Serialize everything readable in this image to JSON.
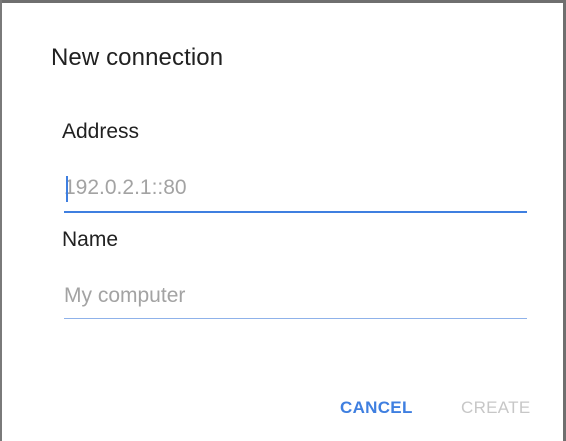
{
  "dialog": {
    "title": "New connection",
    "fields": [
      {
        "label": "Address",
        "value": "",
        "placeholder": "192.0.2.1::80",
        "focused": true
      },
      {
        "label": "Name",
        "value": "",
        "placeholder": "My computer",
        "focused": false
      }
    ],
    "actions": {
      "cancel_label": "CANCEL",
      "create_label": "CREATE",
      "create_enabled": false
    }
  },
  "colors": {
    "accent": "#3f7fe0",
    "text": "#212121",
    "placeholder": "#a3a3a3",
    "disabled": "#c7c7c7"
  }
}
